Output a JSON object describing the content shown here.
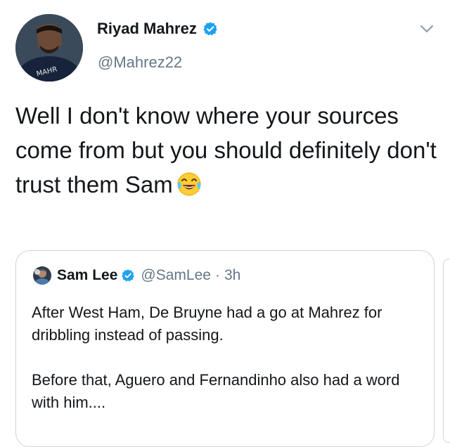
{
  "tweet": {
    "display_name": "Riyad Mahrez",
    "handle": "@Mahrez22",
    "avatar_jersey_text": "MAHR",
    "text": "Well I don't know where your sources come from but you should definitely don't trust them Sam",
    "emoji": "face-with-tears-of-joy"
  },
  "quoted_tweet": {
    "display_name": "Sam Lee",
    "handle": "@SamLee",
    "separator": "·",
    "time": "3h",
    "paragraphs": [
      "After West Ham, De Bruyne had a go at Mahrez for dribbling instead of passing.",
      "Before that, Aguero and Fernandinho also had a word with him...."
    ]
  },
  "colors": {
    "verified": "#1da1f2",
    "handle_gray": "#657786",
    "border": "#ccd6dd"
  },
  "icons": [
    "verified-badge-icon",
    "chevron-down-icon",
    "face-with-tears-of-joy-emoji"
  ]
}
